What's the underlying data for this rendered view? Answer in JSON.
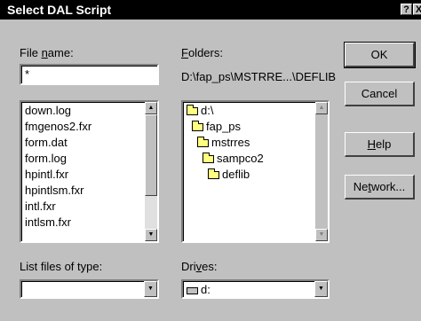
{
  "window": {
    "title": "Select DAL Script",
    "help_glyph": "?",
    "close_glyph": "X"
  },
  "file_name": {
    "label_pre": "File ",
    "label_accel": "n",
    "label_post": "ame:",
    "value": "*",
    "files": [
      "down.log",
      "fmgenos2.fxr",
      "form.dat",
      "form.log",
      "hpintl.fxr",
      "hpintlsm.fxr",
      "intl.fxr",
      "intlsm.fxr"
    ]
  },
  "folders": {
    "label_accel": "F",
    "label_post": "olders:",
    "path": "D:\\fap_ps\\MSTRRE...\\DEFLIB",
    "tree": [
      "d:\\",
      "fap_ps",
      "mstrres",
      "sampco2",
      "deflib"
    ]
  },
  "list_type": {
    "label": "List files of type:",
    "value": ""
  },
  "drives": {
    "label_pre": "Dri",
    "label_accel": "v",
    "label_post": "es:",
    "value": "d:"
  },
  "buttons": {
    "ok": "OK",
    "cancel": "Cancel",
    "help_accel": "H",
    "help_post": "elp",
    "network_pre": "Ne",
    "network_accel": "t",
    "network_post": "work..."
  },
  "icons": {
    "arrow_up": "▲",
    "arrow_down": "▼"
  }
}
